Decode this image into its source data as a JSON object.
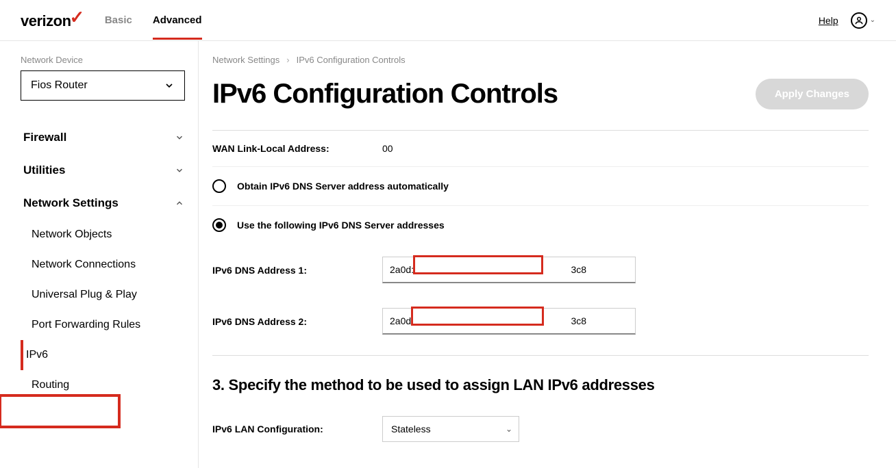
{
  "header": {
    "logo_text": "verizon",
    "tabs": {
      "basic": "Basic",
      "advanced": "Advanced"
    },
    "help": "Help"
  },
  "sidebar": {
    "device_label": "Network Device",
    "device_value": "Fios Router",
    "menu": {
      "firewall": "Firewall",
      "utilities": "Utilities",
      "network_settings": "Network Settings"
    },
    "submenu": {
      "network_objects": "Network Objects",
      "network_connections": "Network Connections",
      "upnp": "Universal Plug & Play",
      "port_forwarding": "Port Forwarding Rules",
      "ipv6": "IPv6",
      "routing": "Routing"
    }
  },
  "breadcrumb": {
    "parent": "Network Settings",
    "current": "IPv6 Configuration Controls"
  },
  "page": {
    "title": "IPv6 Configuration Controls",
    "apply_button": "Apply Changes"
  },
  "form": {
    "wan_link_local_label": "WAN Link-Local Address:",
    "wan_link_local_value": "00",
    "dns_auto_label": "Obtain IPv6 DNS Server address automatically",
    "dns_manual_label": "Use the following IPv6 DNS Server addresses",
    "dns1_label": "IPv6 DNS Address 1:",
    "dns1_value": "2a0d:                                                           3c8",
    "dns2_label": "IPv6 DNS Address 2:",
    "dns2_value": "2a0d                                                            3c8",
    "section3_heading": "3. Specify the method to be used to assign LAN IPv6 addresses",
    "lan_config_label": "IPv6 LAN Configuration:",
    "lan_config_value": "Stateless"
  }
}
